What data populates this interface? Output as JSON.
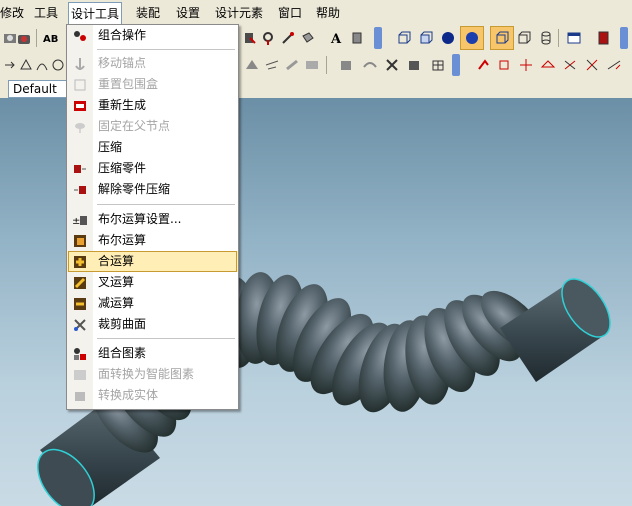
{
  "menubar": {
    "items": [
      {
        "label": "修改"
      },
      {
        "label": "工具"
      },
      {
        "label": "设计工具"
      },
      {
        "label": "装配"
      },
      {
        "label": "设置"
      },
      {
        "label": "设计元素"
      },
      {
        "label": "窗口"
      },
      {
        "label": "帮助"
      }
    ]
  },
  "toolbar": {
    "style_value": "Default"
  },
  "dropdown": {
    "items": [
      {
        "label": "组合操作",
        "enabled": true,
        "icon": "combine-ops-icon"
      },
      {
        "label": "移动锚点",
        "enabled": false,
        "icon": "anchor-icon"
      },
      {
        "label": "重置包围盒",
        "enabled": false,
        "icon": "bounding-box-icon"
      },
      {
        "label": "重新生成",
        "enabled": true,
        "icon": "regenerate-icon"
      },
      {
        "label": "固定在父节点",
        "enabled": false,
        "icon": "pin-parent-icon"
      },
      {
        "label": "压缩",
        "enabled": true,
        "icon": ""
      },
      {
        "label": "压缩零件",
        "enabled": true,
        "icon": "compress-part-icon"
      },
      {
        "label": "解除零件压缩",
        "enabled": true,
        "icon": "uncompress-part-icon"
      },
      {
        "label": "布尔运算设置...",
        "enabled": true,
        "icon": "boolean-settings-icon"
      },
      {
        "label": "布尔运算",
        "enabled": true,
        "icon": "boolean-icon"
      },
      {
        "label": "合运算",
        "enabled": true,
        "icon": "union-icon",
        "highlighted": true
      },
      {
        "label": "叉运算",
        "enabled": true,
        "icon": "intersect-icon"
      },
      {
        "label": "减运算",
        "enabled": true,
        "icon": "subtract-icon"
      },
      {
        "label": "裁剪曲面",
        "enabled": true,
        "icon": "trim-surface-icon"
      },
      {
        "label": "组合图素",
        "enabled": true,
        "icon": "group-shapes-icon"
      },
      {
        "label": "面转换为智能图素",
        "enabled": false,
        "icon": "face-to-smart-icon"
      },
      {
        "label": "转换成实体",
        "enabled": false,
        "icon": "convert-solid-icon"
      }
    ]
  },
  "colors": {
    "menu_highlight": "#ffeeb6",
    "highlight_border": "#c79a32",
    "toolbar_bg": "#ece9d8",
    "edge_cyan": "#2fd0d6"
  }
}
